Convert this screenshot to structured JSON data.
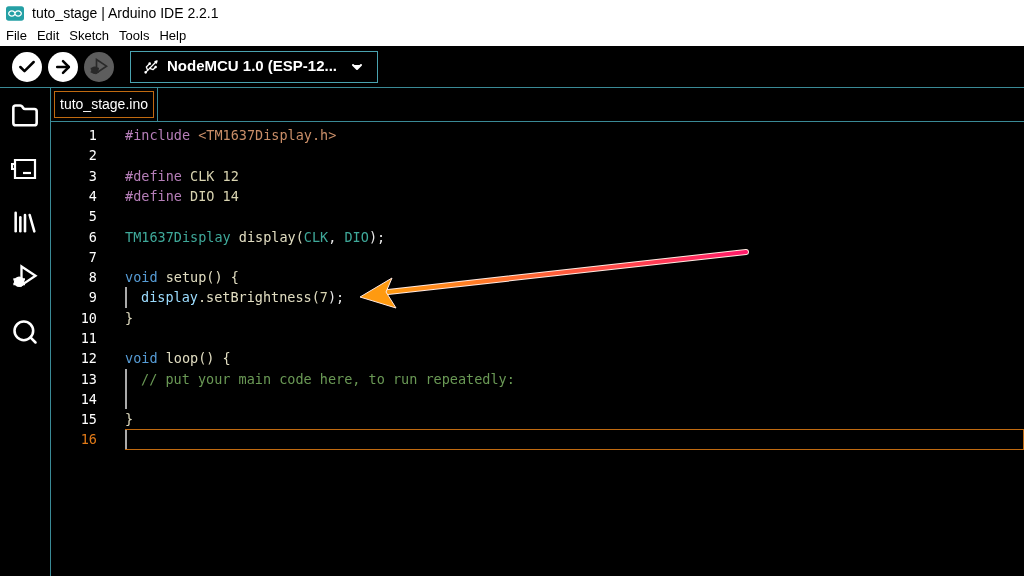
{
  "window": {
    "title": "tuto_stage | Arduino IDE 2.2.1"
  },
  "menu": [
    "File",
    "Edit",
    "Sketch",
    "Tools",
    "Help"
  ],
  "toolbar": {
    "buttons": [
      {
        "kind": "verify",
        "disabled": false
      },
      {
        "kind": "upload",
        "disabled": false
      },
      {
        "kind": "debug",
        "disabled": true
      }
    ],
    "board": "NodeMCU 1.0 (ESP-12..."
  },
  "sidebar": [
    {
      "kind": "folder"
    },
    {
      "kind": "boards"
    },
    {
      "kind": "library"
    },
    {
      "kind": "debug"
    },
    {
      "kind": "search"
    }
  ],
  "tabs": [
    {
      "label": "tuto_stage.ino",
      "selected": true
    }
  ],
  "editor": {
    "lines": [
      {
        "number": "1",
        "current": false,
        "guide": false,
        "tokens": [
          {
            "kind": "preproc",
            "text": "#include"
          },
          {
            "kind": "string",
            "text": " <TM1637Display.h>"
          }
        ]
      },
      {
        "number": "2",
        "current": false,
        "guide": false
      },
      {
        "number": "3",
        "current": false,
        "guide": false,
        "tokens": [
          {
            "kind": "preproc",
            "text": "#define"
          },
          {
            "kind": "plain",
            "text": " CLK 12"
          }
        ]
      },
      {
        "number": "4",
        "current": false,
        "guide": false,
        "tokens": [
          {
            "kind": "preproc",
            "text": "#define"
          },
          {
            "kind": "plain",
            "text": " DIO 14"
          }
        ]
      },
      {
        "number": "5",
        "current": false,
        "guide": false
      },
      {
        "number": "6",
        "current": false,
        "guide": false,
        "tokens": [
          {
            "kind": "type",
            "text": "TM1637Display"
          },
          {
            "kind": "function",
            "text": " display("
          },
          {
            "kind": "type",
            "text": "CLK"
          },
          {
            "kind": "punct",
            "text": ", "
          },
          {
            "kind": "type",
            "text": "DIO"
          },
          {
            "kind": "punct",
            "text": ");"
          }
        ]
      },
      {
        "number": "7",
        "current": false,
        "guide": false
      },
      {
        "number": "8",
        "current": false,
        "guide": false,
        "tokens": [
          {
            "kind": "keyword",
            "text": "void"
          },
          {
            "kind": "function",
            "text": " setup() {"
          }
        ]
      },
      {
        "number": "9",
        "current": false,
        "guide": true,
        "tokens": [
          {
            "kind": "variable",
            "text": "display"
          },
          {
            "kind": "function",
            "text": ".setBrightness("
          },
          {
            "kind": "plain",
            "text": "7"
          },
          {
            "kind": "punct",
            "text": ");"
          }
        ]
      },
      {
        "number": "10",
        "current": false,
        "guide": false,
        "tokens": [
          {
            "kind": "function",
            "text": "}"
          }
        ]
      },
      {
        "number": "11",
        "current": false,
        "guide": false
      },
      {
        "number": "12",
        "current": false,
        "guide": false,
        "tokens": [
          {
            "kind": "keyword",
            "text": "void"
          },
          {
            "kind": "function",
            "text": " loop() {"
          }
        ]
      },
      {
        "number": "13",
        "current": false,
        "guide": true,
        "tokens": [
          {
            "kind": "comment",
            "text": "// put your main code here, to run repeatedly:"
          }
        ]
      },
      {
        "number": "14",
        "current": false,
        "guide": true
      },
      {
        "number": "15",
        "current": false,
        "guide": false,
        "tokens": [
          {
            "kind": "function",
            "text": "}"
          }
        ]
      },
      {
        "number": "16",
        "current": true,
        "guide": false
      }
    ]
  }
}
